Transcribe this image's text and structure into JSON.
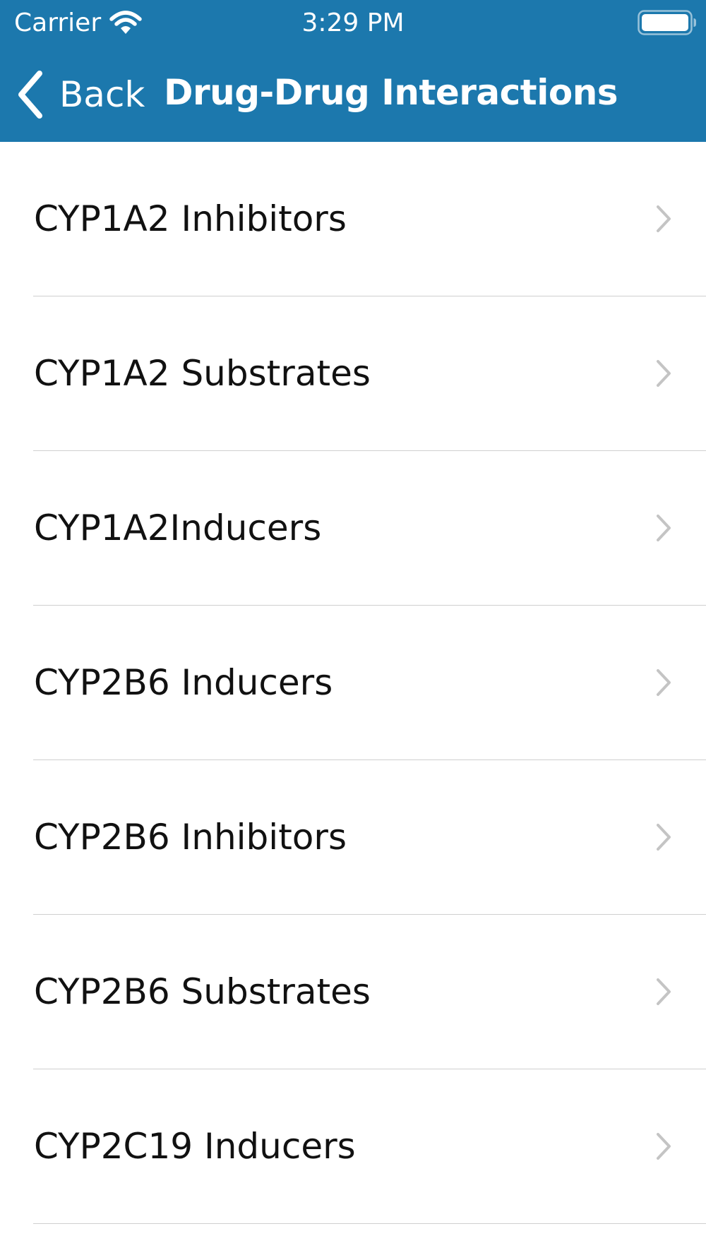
{
  "status_bar": {
    "carrier": "Carrier",
    "time": "3:29 PM"
  },
  "nav": {
    "back_label": "Back",
    "title": "Drug-Drug Interactions"
  },
  "colors": {
    "header_background": "#1c78ad",
    "header_text": "#ffffff",
    "divider": "#cfcfcf",
    "chevron": "#c4c4c4"
  },
  "list": {
    "items": [
      {
        "label": "CYP1A2 Inhibitors"
      },
      {
        "label": "CYP1A2 Substrates"
      },
      {
        "label": "CYP1A2Inducers"
      },
      {
        "label": "CYP2B6 Inducers"
      },
      {
        "label": "CYP2B6 Inhibitors"
      },
      {
        "label": "CYP2B6 Substrates"
      },
      {
        "label": "CYP2C19 Inducers"
      }
    ]
  }
}
